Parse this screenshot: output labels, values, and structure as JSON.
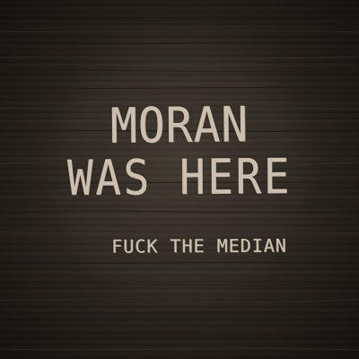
{
  "scene": {
    "description_colors": {
      "wood_base": "#2b2620",
      "scratch_text": "#cdbfae"
    },
    "text": {
      "line_1": "MORAN",
      "line_2": "WAS HERE",
      "line_3": "FUCK THE MEDIAN"
    }
  }
}
